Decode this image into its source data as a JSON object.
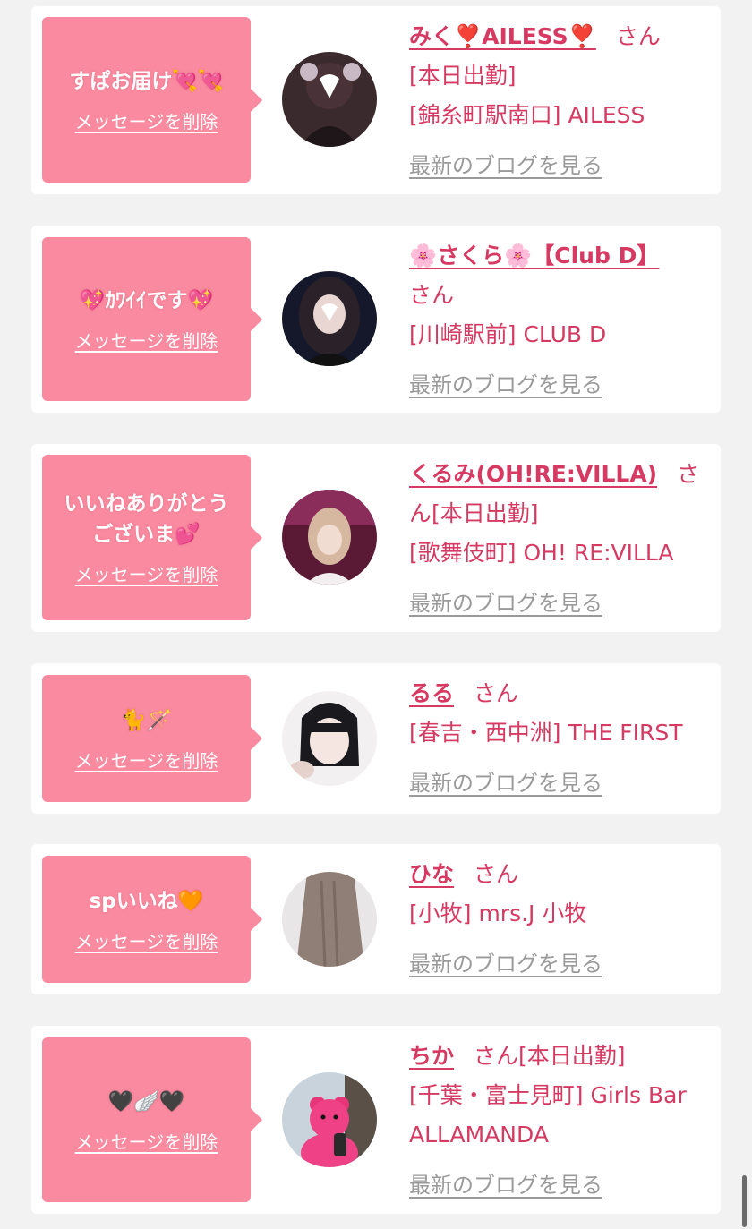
{
  "common": {
    "delete_label": "メッセージを削除",
    "san": "さん",
    "blog_label": "最新のブログを見る"
  },
  "colors": {
    "bubble": "#f98a9f",
    "name": "#d63a62",
    "blog": "#9a9a9a"
  },
  "cards": [
    {
      "message": "すぱお届け💘💘",
      "name": "みく❣️AILESS❣️",
      "status": "[本日出勤]",
      "shop": "[錦糸町駅南口] AILESS",
      "avatar_icon": "girl-photo-icon"
    },
    {
      "message": "💖ｶﾜｲｲです💖",
      "name": "🌸さくら🌸【Club D】",
      "status": "",
      "shop": "[川崎駅前] CLUB D",
      "avatar_icon": "girl-photo-icon"
    },
    {
      "message": "いいねありがとうございま💕",
      "name": "くるみ(OH!RE:VILLA)",
      "status": "[本日出勤]",
      "shop": "[歌舞伎町] OH! RE:VILLA",
      "avatar_icon": "girl-photo-icon"
    },
    {
      "message": "🐈🪄",
      "name": "るる",
      "status": "",
      "shop": "[春吉・西中洲] THE FIRST",
      "avatar_icon": "girl-photo-icon"
    },
    {
      "message": "spいいね🧡",
      "name": "ひな",
      "status": "",
      "shop": "[小牧] mrs.J 小牧",
      "avatar_icon": "hair-photo-icon"
    },
    {
      "message": "🖤🪽🖤",
      "name": "ちか",
      "status": "[本日出勤]",
      "shop": "[千葉・富士見町] Girls Bar ALLAMANDA",
      "avatar_icon": "teddy-bear-photo-icon"
    }
  ]
}
